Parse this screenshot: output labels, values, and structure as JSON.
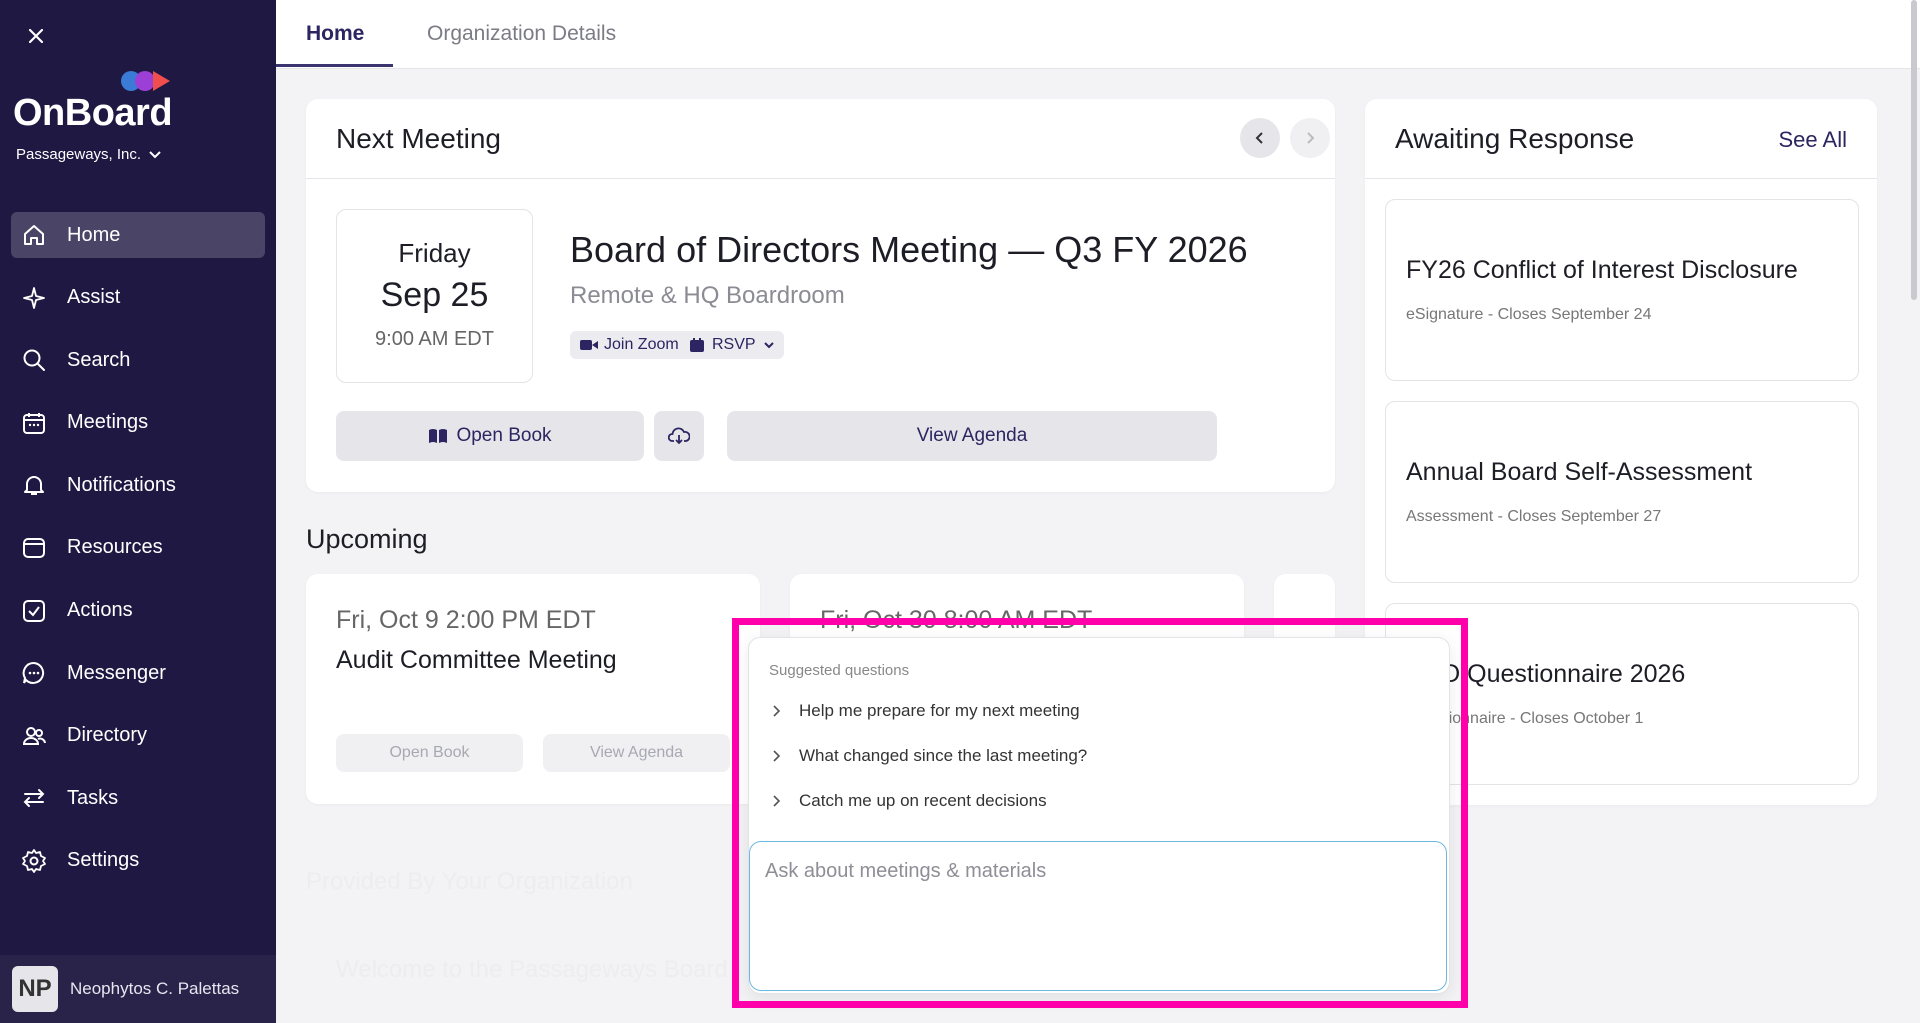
{
  "sidebar": {
    "logo_text": "OnBoard",
    "org_name": "Passageways, Inc.",
    "items": [
      {
        "label": "Home",
        "icon": "home-icon"
      },
      {
        "label": "Assist",
        "icon": "sparkle-icon"
      },
      {
        "label": "Search",
        "icon": "search-icon"
      },
      {
        "label": "Meetings",
        "icon": "calendar-icon"
      },
      {
        "label": "Notifications",
        "icon": "bell-icon"
      },
      {
        "label": "Resources",
        "icon": "folder-icon"
      },
      {
        "label": "Actions",
        "icon": "check-square-icon"
      },
      {
        "label": "Messenger",
        "icon": "chat-icon"
      },
      {
        "label": "Directory",
        "icon": "people-icon"
      },
      {
        "label": "Tasks",
        "icon": "swap-icon"
      },
      {
        "label": "Settings",
        "icon": "gear-icon"
      }
    ],
    "user": {
      "initials": "NP",
      "name": "Neophytos C. Palettas"
    }
  },
  "tabs": {
    "home": "Home",
    "org": "Organization Details"
  },
  "next_meeting": {
    "heading": "Next Meeting",
    "day": "Friday",
    "date": "Sep 25",
    "time": "9:00 AM EDT",
    "title": "Board of Directors Meeting — Q3 FY 2026",
    "location": "Remote & HQ Boardroom",
    "join_label": "Join Zoom",
    "rsvp_label": "RSVP",
    "open_book": "Open Book",
    "view_agenda": "View Agenda"
  },
  "upcoming": {
    "heading": "Upcoming",
    "items": [
      {
        "date": "Fri, Oct 9 2:00 PM EDT",
        "title": "Audit Committee Meeting",
        "open_book": "Open Book",
        "view_agenda": "View Agenda"
      },
      {
        "date": "Fri, Oct 30 8:00 AM EDT"
      }
    ]
  },
  "awaiting": {
    "heading": "Awaiting Response",
    "see_all": "See All",
    "items": [
      {
        "title": "FY26 Conflict of Interest Disclosure",
        "sub": "eSignature - Closes September 24"
      },
      {
        "title": "Annual Board Self-Assessment",
        "sub": "Assessment - Closes September 27"
      },
      {
        "title": "D&O Questionnaire 2026",
        "sub": "Questionnaire - Closes October 1"
      }
    ]
  },
  "background_text": {
    "provided": "Provided By Your Organization",
    "welcome": "Welcome to the Passageways Board"
  },
  "assist_popup": {
    "suggested_label": "Suggested questions",
    "suggestions": [
      "Help me prepare for my next meeting",
      "What changed since the last meeting?",
      "Catch me up on recent decisions"
    ],
    "input_placeholder": "Ask about meetings & materials"
  },
  "colors": {
    "sidebar": "#1f1842",
    "accent": "#2c2561",
    "highlight": "#ff00aa"
  }
}
